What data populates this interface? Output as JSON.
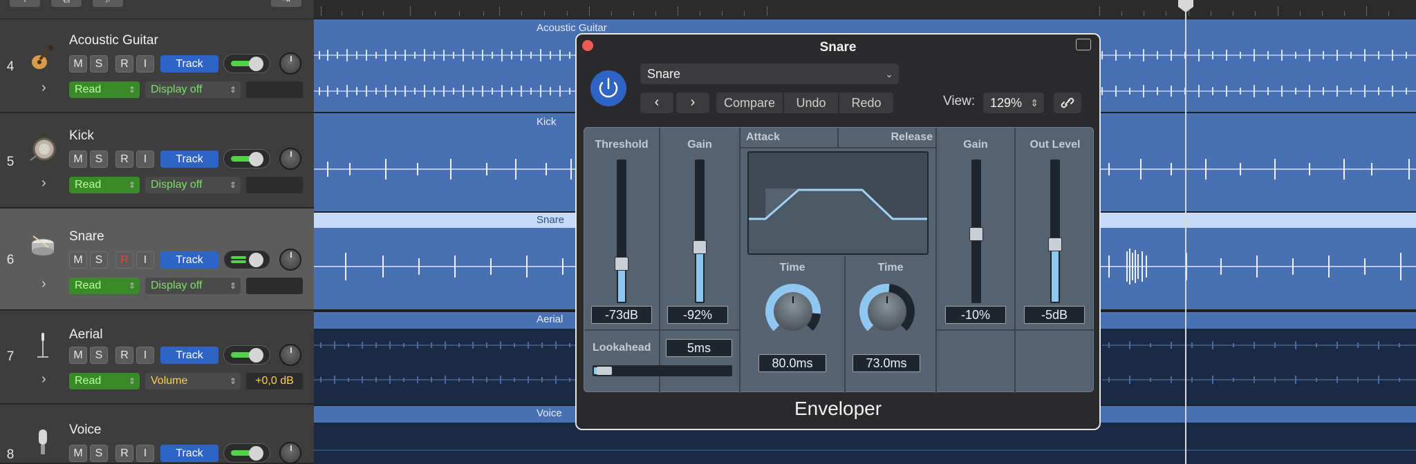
{
  "tracks": [
    {
      "number": "4",
      "name": "Acoustic Guitar",
      "mute": "M",
      "solo": "S",
      "rec": "R",
      "input": "I",
      "track_btn": "Track",
      "automation_mode": "Read",
      "automation_param": "Display off",
      "value": "",
      "region_label": "Acoustic Guitar"
    },
    {
      "number": "5",
      "name": "Kick",
      "mute": "M",
      "solo": "S",
      "rec": "R",
      "input": "I",
      "track_btn": "Track",
      "automation_mode": "Read",
      "automation_param": "Display off",
      "value": "",
      "region_label": "Kick"
    },
    {
      "number": "6",
      "name": "Snare",
      "mute": "M",
      "solo": "S",
      "rec": "R",
      "input": "I",
      "track_btn": "Track",
      "automation_mode": "Read",
      "automation_param": "Display off",
      "value": "",
      "region_label": "Snare"
    },
    {
      "number": "7",
      "name": "Aerial",
      "mute": "M",
      "solo": "S",
      "rec": "R",
      "input": "I",
      "track_btn": "Track",
      "automation_mode": "Read",
      "automation_param": "Volume",
      "value": "+0,0 dB",
      "region_label": "Aerial"
    },
    {
      "number": "8",
      "name": "Voice",
      "mute": "M",
      "solo": "S",
      "rec": "R",
      "input": "I",
      "track_btn": "Track",
      "region_label": "Voice"
    }
  ],
  "plugin": {
    "window_title": "Snare",
    "preset": "Snare",
    "nav_prev": "‹",
    "nav_next": "›",
    "compare": "Compare",
    "undo": "Undo",
    "redo": "Redo",
    "view_label": "View:",
    "zoom": "129%",
    "plugin_name": "Enveloper",
    "threshold": {
      "label": "Threshold",
      "value": "-73dB",
      "level": 0.25
    },
    "gain_in": {
      "label": "Gain",
      "value": "-92%",
      "level": 0.38
    },
    "attack": {
      "label": "Attack",
      "time_label": "Time",
      "value": "80.0ms"
    },
    "release": {
      "label": "Release",
      "time_label": "Time",
      "value": "73.0ms"
    },
    "gain_out": {
      "label": "Gain",
      "value": "-10%",
      "level": 0.48
    },
    "out_level": {
      "label": "Out Level",
      "value": "-5dB",
      "level": 0.4
    },
    "lookahead": {
      "label": "Lookahead",
      "value": "5ms"
    }
  },
  "colors": {
    "accent": "#2f64c7",
    "region": "#4870b2",
    "fader_fill": "#8fc7f0"
  }
}
